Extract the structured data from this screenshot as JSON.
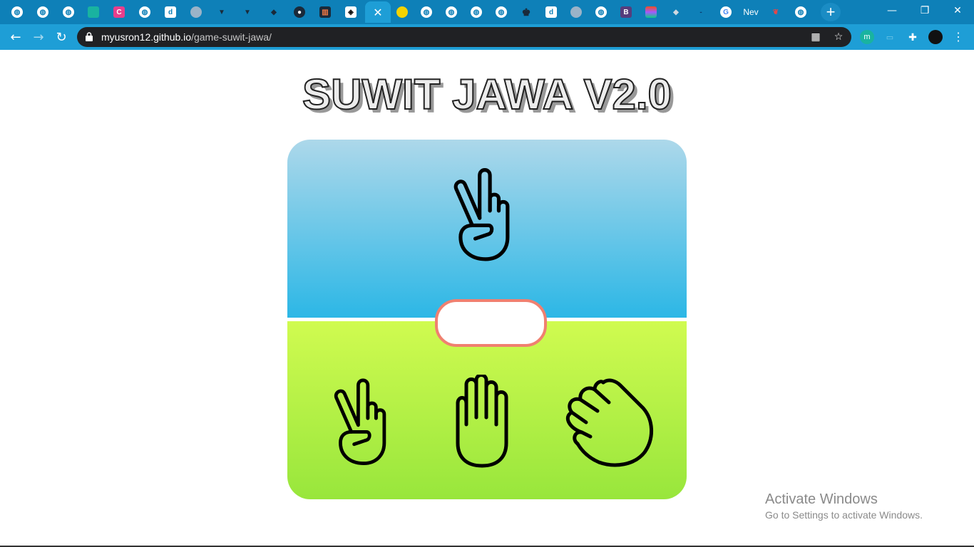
{
  "browser": {
    "active_tab_close": "✕",
    "new_tab_label": "+",
    "partial_tab_label": "Nev",
    "url_host": "myusron12.github.io",
    "url_path": "/game-suwit-jawa/",
    "window_controls": {
      "minimize": "—",
      "restore": "❐",
      "close": "✕"
    },
    "nav": {
      "back": "←",
      "forward": "→",
      "reload": "↻"
    },
    "omni_icons": {
      "qr": "▦",
      "bookmark": "☆"
    },
    "ext_icons": {
      "m": "m",
      "puzzle": "✚",
      "menu": "⋮"
    }
  },
  "game": {
    "title": "SUWIT JAWA V2.0",
    "computer_choice_icon": "scissors-hand-icon",
    "result_text": "",
    "choices": [
      {
        "name": "gunting",
        "icon": "scissors-hand-icon"
      },
      {
        "name": "kertas",
        "icon": "paper-hand-icon"
      },
      {
        "name": "batu",
        "icon": "rock-fist-icon"
      }
    ],
    "colors": {
      "computer_top": "#add8ea",
      "computer_bottom": "#2cb7e6",
      "player_top": "#d0fb50",
      "player_bottom": "#98e63c",
      "result_border": "#f08070"
    }
  },
  "os": {
    "activate_title": "Activate Windows",
    "activate_subtitle": "Go to Settings to activate Windows."
  }
}
